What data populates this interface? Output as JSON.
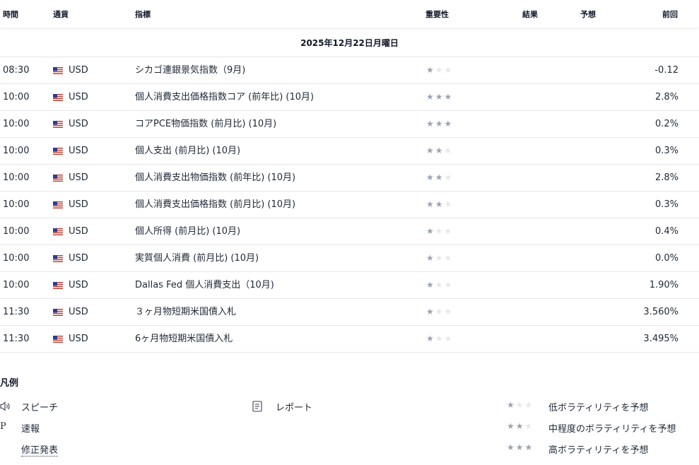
{
  "header": {
    "time": "時間",
    "currency": "通貨",
    "indicator": "指標",
    "importance": "重要性",
    "result": "結果",
    "forecast": "予想",
    "previous": "前回"
  },
  "date": "2025年12月22日月曜日",
  "events": [
    {
      "time": "08:30",
      "currency": "USD",
      "name": "シカゴ連銀景気指数（9月)",
      "stars": 1,
      "previous": "-0.12"
    },
    {
      "time": "10:00",
      "currency": "USD",
      "name": "個人消費支出価格指数コア (前年比) (10月)",
      "stars": 3,
      "previous": "2.8%"
    },
    {
      "time": "10:00",
      "currency": "USD",
      "name": "コアPCE物価指数 (前月比) (10月)",
      "stars": 3,
      "previous": "0.2%"
    },
    {
      "time": "10:00",
      "currency": "USD",
      "name": "個人支出 (前月比) (10月)",
      "stars": 2,
      "previous": "0.3%"
    },
    {
      "time": "10:00",
      "currency": "USD",
      "name": "個人消費支出物価指数 (前年比) (10月)",
      "stars": 2,
      "previous": "2.8%"
    },
    {
      "time": "10:00",
      "currency": "USD",
      "name": "個人消費支出価格指数 (前月比) (10月)",
      "stars": 2,
      "previous": "0.3%"
    },
    {
      "time": "10:00",
      "currency": "USD",
      "name": "個人所得 (前月比) (10月)",
      "stars": 1,
      "previous": "0.4%"
    },
    {
      "time": "10:00",
      "currency": "USD",
      "name": "実質個人消費 (前月比) (10月)",
      "stars": 1,
      "previous": "0.0%"
    },
    {
      "time": "10:00",
      "currency": "USD",
      "name": "Dallas Fed 個人消費支出（10月)",
      "stars": 1,
      "previous": "1.90%"
    },
    {
      "time": "11:30",
      "currency": "USD",
      "name": "３ヶ月物短期米国債入札",
      "stars": 1,
      "previous": "3.560%"
    },
    {
      "time": "11:30",
      "currency": "USD",
      "name": "6ヶ月物短期米国債入札",
      "stars": 1,
      "previous": "3.495%"
    }
  ],
  "legend": {
    "title": "凡例",
    "speech": "スピーチ",
    "report": "レポート",
    "preliminary_icon_text": "P",
    "preliminary": "速報",
    "revised": "修正発表",
    "low": "低ボラティリティを予想",
    "medium": "中程度のボラティリティを予想",
    "high": "高ボラティリティを予想"
  },
  "icons": {
    "flag": "us-flag-icon",
    "star": "star-icon",
    "speech": "speaker-icon",
    "report": "document-icon"
  },
  "colors": {
    "star_on": "#9ca3af",
    "star_off": "#e5e7eb",
    "border": "#e5e7eb"
  }
}
